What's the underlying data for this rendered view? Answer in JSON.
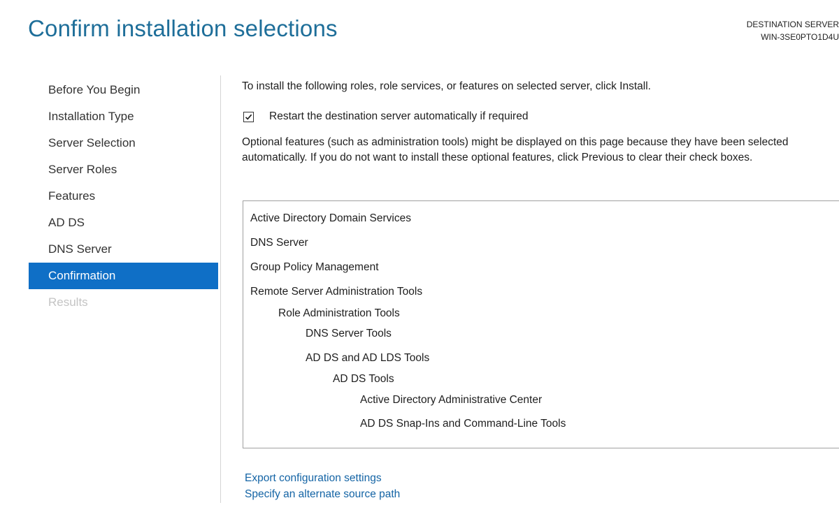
{
  "header": {
    "title": "Confirm installation selections",
    "destination_label": "DESTINATION SERVER",
    "destination_server": "WIN-3SE0PTO1D4U"
  },
  "nav": {
    "items": [
      {
        "label": "Before You Begin",
        "state": "normal"
      },
      {
        "label": "Installation Type",
        "state": "normal"
      },
      {
        "label": "Server Selection",
        "state": "normal"
      },
      {
        "label": "Server Roles",
        "state": "normal"
      },
      {
        "label": "Features",
        "state": "normal"
      },
      {
        "label": "AD DS",
        "state": "normal"
      },
      {
        "label": "DNS Server",
        "state": "normal"
      },
      {
        "label": "Confirmation",
        "state": "active"
      },
      {
        "label": "Results",
        "state": "disabled"
      }
    ]
  },
  "content": {
    "intro": "To install the following roles, role services, or features on selected server, click Install.",
    "restart": {
      "label": "Restart the destination server automatically if required",
      "checked": true
    },
    "note": "Optional features (such as administration tools) might be displayed on this page because they have been selected automatically. If you do not want to install these optional features, click Previous to clear their check boxes.",
    "features": [
      {
        "label": "Active Directory Domain Services",
        "level": 0
      },
      {
        "label": "DNS Server",
        "level": 0
      },
      {
        "label": "Group Policy Management",
        "level": 0
      },
      {
        "label": "Remote Server Administration Tools",
        "level": 0
      },
      {
        "label": "Role Administration Tools",
        "level": 1
      },
      {
        "label": "DNS Server Tools",
        "level": 2
      },
      {
        "label": "AD DS and AD LDS Tools",
        "level": 2
      },
      {
        "label": "AD DS Tools",
        "level": 3
      },
      {
        "label": "Active Directory Administrative Center",
        "level": 4
      },
      {
        "label": "AD DS Snap-Ins and Command-Line Tools",
        "level": 4
      }
    ],
    "links": {
      "export": "Export configuration settings",
      "alternate_source": "Specify an alternate source path"
    }
  },
  "colors": {
    "title": "#1e6e99",
    "nav_active_bg": "#0f6fc6",
    "link": "#1464a5"
  },
  "icons": {
    "checkbox": "checkmark-icon"
  }
}
